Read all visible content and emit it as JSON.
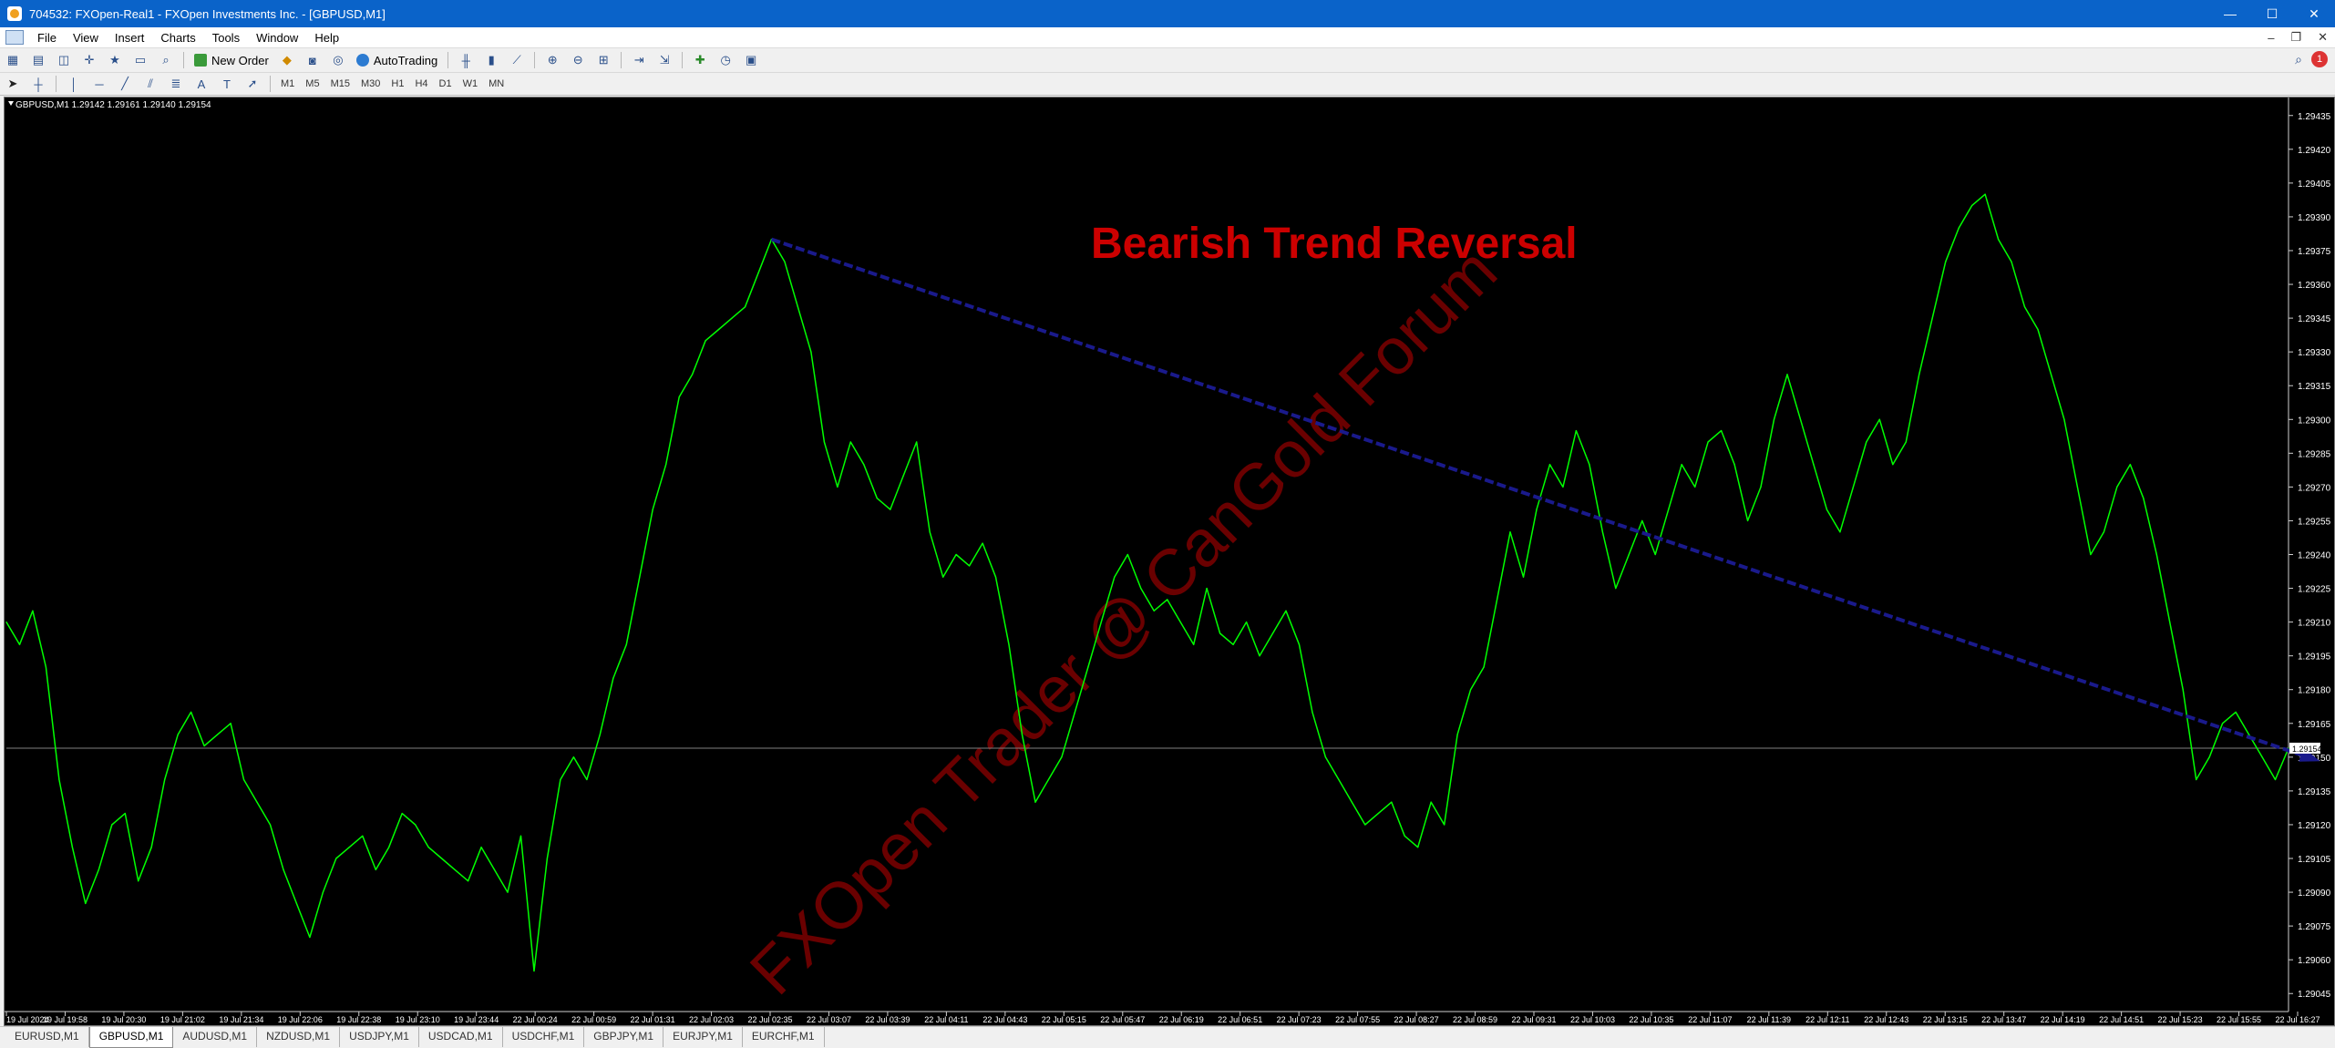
{
  "window": {
    "title": "704532: FXOpen-Real1 - FXOpen Investments Inc. - [GBPUSD,M1]",
    "minimize_label": "—",
    "maximize_label": "☐",
    "close_label": "✕"
  },
  "menu": [
    "File",
    "View",
    "Insert",
    "Charts",
    "Tools",
    "Window",
    "Help"
  ],
  "toolbar": {
    "new_order_label": "New Order",
    "autotrading_label": "AutoTrading"
  },
  "timeframes": [
    "M1",
    "M5",
    "M15",
    "M30",
    "H1",
    "H4",
    "D1",
    "W1",
    "MN"
  ],
  "chart": {
    "header": "GBPUSD,M1  1.29142 1.29161 1.29140 1.29154",
    "annotation": "Bearish Trend Reversal",
    "watermark": "FXOpen Trader @ CanGold Forum",
    "current_price_label": "1.29154",
    "colors": {
      "background": "#000000",
      "line": "#00ff00",
      "trendline": "#1a1a8c",
      "annotation": "#cc0000",
      "watermark": "#6a0000",
      "price_line": "#808080"
    }
  },
  "chart_data": {
    "type": "line",
    "series": [
      {
        "name": "GBPUSD,M1",
        "values": [
          1.2921,
          1.292,
          1.29215,
          1.2919,
          1.2914,
          1.2911,
          1.29085,
          1.291,
          1.2912,
          1.29125,
          1.29095,
          1.2911,
          1.2914,
          1.2916,
          1.2917,
          1.29155,
          1.2916,
          1.29165,
          1.2914,
          1.2913,
          1.2912,
          1.291,
          1.29085,
          1.2907,
          1.2909,
          1.29105,
          1.2911,
          1.29115,
          1.291,
          1.2911,
          1.29125,
          1.2912,
          1.2911,
          1.29105,
          1.291,
          1.29095,
          1.2911,
          1.291,
          1.2909,
          1.29115,
          1.29055,
          1.29105,
          1.2914,
          1.2915,
          1.2914,
          1.2916,
          1.29185,
          1.292,
          1.2923,
          1.2926,
          1.2928,
          1.2931,
          1.2932,
          1.29335,
          1.2934,
          1.29345,
          1.2935,
          1.29365,
          1.2938,
          1.2937,
          1.2935,
          1.2933,
          1.2929,
          1.2927,
          1.2929,
          1.2928,
          1.29265,
          1.2926,
          1.29275,
          1.2929,
          1.2925,
          1.2923,
          1.2924,
          1.29235,
          1.29245,
          1.2923,
          1.292,
          1.2916,
          1.2913,
          1.2914,
          1.2915,
          1.2917,
          1.2919,
          1.2921,
          1.2923,
          1.2924,
          1.29225,
          1.29215,
          1.2922,
          1.2921,
          1.292,
          1.29225,
          1.29205,
          1.292,
          1.2921,
          1.29195,
          1.29205,
          1.29215,
          1.292,
          1.2917,
          1.2915,
          1.2914,
          1.2913,
          1.2912,
          1.29125,
          1.2913,
          1.29115,
          1.2911,
          1.2913,
          1.2912,
          1.2916,
          1.2918,
          1.2919,
          1.2922,
          1.2925,
          1.2923,
          1.2926,
          1.2928,
          1.2927,
          1.29295,
          1.2928,
          1.2925,
          1.29225,
          1.2924,
          1.29255,
          1.2924,
          1.2926,
          1.2928,
          1.2927,
          1.2929,
          1.29295,
          1.2928,
          1.29255,
          1.2927,
          1.293,
          1.2932,
          1.293,
          1.2928,
          1.2926,
          1.2925,
          1.2927,
          1.2929,
          1.293,
          1.2928,
          1.2929,
          1.2932,
          1.29345,
          1.2937,
          1.29385,
          1.29395,
          1.294,
          1.2938,
          1.2937,
          1.2935,
          1.2934,
          1.2932,
          1.293,
          1.2927,
          1.2924,
          1.2925,
          1.2927,
          1.2928,
          1.29265,
          1.2924,
          1.2921,
          1.2918,
          1.2914,
          1.2915,
          1.29165,
          1.2917,
          1.2916,
          1.2915,
          1.2914,
          1.29154
        ]
      }
    ],
    "x_tick_labels": [
      "19 Jul 2024",
      "19 Jul 19:58",
      "19 Jul 20:30",
      "19 Jul 21:02",
      "19 Jul 21:34",
      "19 Jul 22:06",
      "19 Jul 22:38",
      "19 Jul 23:10",
      "19 Jul 23:44",
      "22 Jul 00:24",
      "22 Jul 00:59",
      "22 Jul 01:31",
      "22 Jul 02:03",
      "22 Jul 02:35",
      "22 Jul 03:07",
      "22 Jul 03:39",
      "22 Jul 04:11",
      "22 Jul 04:43",
      "22 Jul 05:15",
      "22 Jul 05:47",
      "22 Jul 06:19",
      "22 Jul 06:51",
      "22 Jul 07:23",
      "22 Jul 07:55",
      "22 Jul 08:27",
      "22 Jul 08:59",
      "22 Jul 09:31",
      "22 Jul 10:03",
      "22 Jul 10:35",
      "22 Jul 11:07",
      "22 Jul 11:39",
      "22 Jul 12:11",
      "22 Jul 12:43",
      "22 Jul 13:15",
      "22 Jul 13:47",
      "22 Jul 14:19",
      "22 Jul 14:51",
      "22 Jul 15:23",
      "22 Jul 15:55",
      "22 Jul 16:27"
    ],
    "y_tick_labels": [
      "1.29435",
      "1.29420",
      "1.29405",
      "1.29390",
      "1.29375",
      "1.29360",
      "1.29345",
      "1.29330",
      "1.29315",
      "1.29300",
      "1.29285",
      "1.29270",
      "1.29255",
      "1.29240",
      "1.29225",
      "1.29210",
      "1.29195",
      "1.29180",
      "1.29165",
      "1.29150",
      "1.29135",
      "1.29120",
      "1.29105",
      "1.29090",
      "1.29075",
      "1.29060",
      "1.29045"
    ],
    "y_ticks": [
      1.29435,
      1.2942,
      1.29405,
      1.2939,
      1.29375,
      1.2936,
      1.29345,
      1.2933,
      1.29315,
      1.293,
      1.29285,
      1.2927,
      1.29255,
      1.2924,
      1.29225,
      1.2921,
      1.29195,
      1.2918,
      1.29165,
      1.2915,
      1.29135,
      1.2912,
      1.29105,
      1.2909,
      1.29075,
      1.2906,
      1.29045
    ],
    "ylim": [
      1.29037,
      1.29443
    ],
    "current_price": 1.29154,
    "trendline": {
      "start_index": 58,
      "start_value": 1.2938,
      "end_index": 175,
      "end_value": 1.29149
    },
    "grid": false
  },
  "symbol_tabs": [
    "EURUSD,M1",
    "GBPUSD,M1",
    "AUDUSD,M1",
    "NZDUSD,M1",
    "USDJPY,M1",
    "USDCAD,M1",
    "USDCHF,M1",
    "GBPJPY,M1",
    "EURJPY,M1",
    "EURCHF,M1"
  ],
  "active_tab": "GBPUSD,M1"
}
